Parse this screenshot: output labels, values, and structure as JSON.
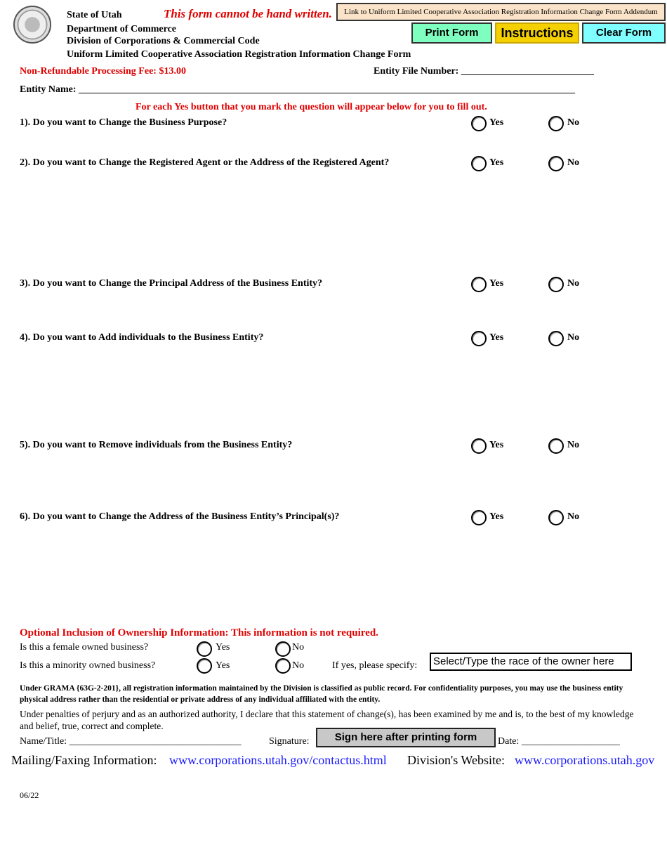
{
  "header": {
    "line1": "State of Utah",
    "line2": "Department of Commerce",
    "line3": "Division of Corporations & Commercial Code",
    "line4": "Uniform Limited Cooperative Association Registration Information Change Form",
    "warning": "This form cannot be hand written.",
    "seal_icon": "utah-state-seal"
  },
  "buttons": {
    "addendum": "Link to Uniform Limited Cooperative Association Registration Information Change Form Addendum",
    "print": "Print Form",
    "instructions": "Instructions",
    "clear": "Clear Form",
    "print_color": "#7fffbf",
    "instructions_color": "#f5d000",
    "clear_color": "#7fffff",
    "addendum_color": "#fae3c8"
  },
  "fee": "Non-Refundable Processing Fee: $13.00",
  "file_number_label": "Entity File Number: ___________________________",
  "entity_name_label": "Entity Name: _____________________________________________________________________________________________________",
  "instruction_note": "For each Yes button that you mark the question will appear below for you to fill out.",
  "yes_label": "Yes",
  "no_label": "No",
  "questions": [
    "1). Do you want to Change the Business Purpose?",
    "2). Do you want to Change the Registered Agent or the Address of the Registered Agent?",
    "3). Do you want to Change the Principal Address of the Business Entity?",
    "4). Do you want to Add individuals to the Business Entity?",
    "5). Do you want to Remove individuals from the Business Entity?",
    "6). Do you want to Change the Address of the Business Entity’s Principal(s)?"
  ],
  "ownership": {
    "title": "Optional Inclusion of Ownership Information:  This information is not required.",
    "female": "Is this a female owned business?",
    "minority": "Is this a minority owned business?",
    "specify": "If yes, please specify:",
    "race_placeholder": "Select/Type the race of the owner here"
  },
  "grama": "Under GRAMA {63G-2-201}, all registration information maintained by the Division is classified as public record.  For confidentiality purposes, you may use the business entity physical address rather than the residential or private address of any individual affiliated with the entity.",
  "perjury": "Under penalties of perjury and as an authorized authority, I declare that this statement of change(s), has been examined by me and is, to the best of my knowledge and belief, true, correct and complete.",
  "signature": {
    "name_title": "Name/Title: ___________________________________",
    "signature_label": "Signature:",
    "sign_button": "Sign here after printing form",
    "date": "Date: ____________________"
  },
  "footer": {
    "mailing_label": "Mailing/Faxing Information:",
    "mailing_link": "www.corporations.utah.gov/contactus.html",
    "website_label": "Division's Website:",
    "website_link": "www.corporations.utah.gov",
    "version": "06/22"
  }
}
